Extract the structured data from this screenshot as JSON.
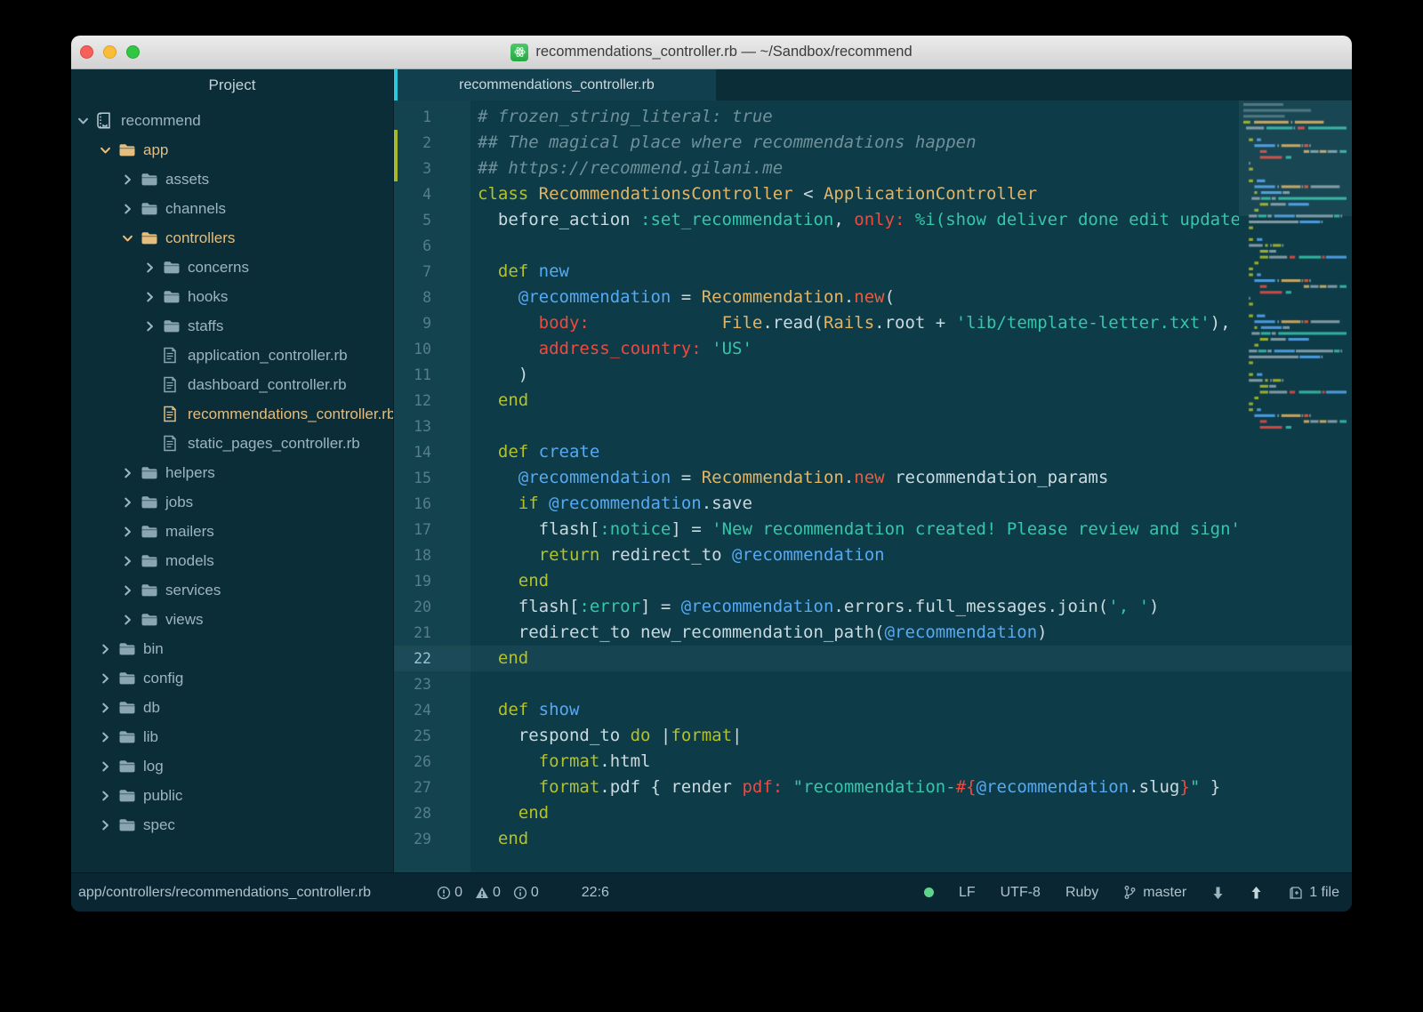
{
  "window": {
    "title": "recommendations_controller.rb — ~/Sandbox/recommend"
  },
  "sidebar": {
    "header": "Project",
    "tree": [
      {
        "label": "recommend",
        "icon": "book",
        "indent": 0,
        "chevron": "expanded",
        "accent": false
      },
      {
        "label": "app",
        "icon": "folder",
        "indent": 1,
        "chevron": "expanded",
        "accent": true
      },
      {
        "label": "assets",
        "icon": "folder",
        "indent": 2,
        "chevron": "collapsed",
        "accent": false
      },
      {
        "label": "channels",
        "icon": "folder",
        "indent": 2,
        "chevron": "collapsed",
        "accent": false
      },
      {
        "label": "controllers",
        "icon": "folder",
        "indent": 2,
        "chevron": "expanded",
        "accent": true
      },
      {
        "label": "concerns",
        "icon": "folder",
        "indent": 3,
        "chevron": "collapsed",
        "accent": false
      },
      {
        "label": "hooks",
        "icon": "folder",
        "indent": 3,
        "chevron": "collapsed",
        "accent": false
      },
      {
        "label": "staffs",
        "icon": "folder",
        "indent": 3,
        "chevron": "collapsed",
        "accent": false
      },
      {
        "label": "application_controller.rb",
        "icon": "file",
        "indent": 3,
        "chevron": "none",
        "accent": false
      },
      {
        "label": "dashboard_controller.rb",
        "icon": "file",
        "indent": 3,
        "chevron": "none",
        "accent": false
      },
      {
        "label": "recommendations_controller.rb",
        "icon": "file",
        "indent": 3,
        "chevron": "none",
        "accent": true
      },
      {
        "label": "static_pages_controller.rb",
        "icon": "file",
        "indent": 3,
        "chevron": "none",
        "accent": false
      },
      {
        "label": "helpers",
        "icon": "folder",
        "indent": 2,
        "chevron": "collapsed",
        "accent": false
      },
      {
        "label": "jobs",
        "icon": "folder",
        "indent": 2,
        "chevron": "collapsed",
        "accent": false
      },
      {
        "label": "mailers",
        "icon": "folder",
        "indent": 2,
        "chevron": "collapsed",
        "accent": false
      },
      {
        "label": "models",
        "icon": "folder",
        "indent": 2,
        "chevron": "collapsed",
        "accent": false
      },
      {
        "label": "services",
        "icon": "folder",
        "indent": 2,
        "chevron": "collapsed",
        "accent": false
      },
      {
        "label": "views",
        "icon": "folder",
        "indent": 2,
        "chevron": "collapsed",
        "accent": false
      },
      {
        "label": "bin",
        "icon": "folder",
        "indent": 1,
        "chevron": "collapsed",
        "accent": false
      },
      {
        "label": "config",
        "icon": "folder",
        "indent": 1,
        "chevron": "collapsed",
        "accent": false
      },
      {
        "label": "db",
        "icon": "folder",
        "indent": 1,
        "chevron": "collapsed",
        "accent": false
      },
      {
        "label": "lib",
        "icon": "folder",
        "indent": 1,
        "chevron": "collapsed",
        "accent": false
      },
      {
        "label": "log",
        "icon": "folder",
        "indent": 1,
        "chevron": "collapsed",
        "accent": false
      },
      {
        "label": "public",
        "icon": "folder",
        "indent": 1,
        "chevron": "collapsed",
        "accent": false
      },
      {
        "label": "spec",
        "icon": "folder",
        "indent": 1,
        "chevron": "collapsed",
        "accent": false
      }
    ]
  },
  "editor": {
    "tab": "recommendations_controller.rb",
    "cursor_line": 22,
    "git_modified_lines": [
      2,
      3
    ],
    "lines": [
      {
        "n": 1,
        "tokens": [
          [
            "comment",
            "# frozen_string_literal: true"
          ]
        ]
      },
      {
        "n": 2,
        "tokens": [
          [
            "comment",
            "## The magical place where recommendations happen"
          ]
        ]
      },
      {
        "n": 3,
        "tokens": [
          [
            "comment",
            "## https://recommend.gilani.me"
          ]
        ]
      },
      {
        "n": 4,
        "tokens": [
          [
            "kw",
            "class"
          ],
          [
            "plain",
            " "
          ],
          [
            "const",
            "RecommendationsController"
          ],
          [
            "plain",
            " < "
          ],
          [
            "const",
            "ApplicationController"
          ]
        ]
      },
      {
        "n": 5,
        "tokens": [
          [
            "plain",
            "  before_action "
          ],
          [
            "sym",
            ":set_recommendation"
          ],
          [
            "plain",
            ", "
          ],
          [
            "kwarg",
            "only:"
          ],
          [
            "plain",
            " "
          ],
          [
            "str",
            "%i(show deliver done edit update destroy)"
          ]
        ]
      },
      {
        "n": 6,
        "tokens": []
      },
      {
        "n": 7,
        "tokens": [
          [
            "plain",
            "  "
          ],
          [
            "kw",
            "def"
          ],
          [
            "plain",
            " "
          ],
          [
            "fname",
            "new"
          ]
        ]
      },
      {
        "n": 8,
        "tokens": [
          [
            "plain",
            "    "
          ],
          [
            "ivar",
            "@recommendation"
          ],
          [
            "plain",
            " = "
          ],
          [
            "const",
            "Recommendation"
          ],
          [
            "plain",
            "."
          ],
          [
            "mcall",
            "new"
          ],
          [
            "plain",
            "("
          ]
        ]
      },
      {
        "n": 9,
        "tokens": [
          [
            "plain",
            "      "
          ],
          [
            "kwarg",
            "body:"
          ],
          [
            "plain",
            "             "
          ],
          [
            "const",
            "File"
          ],
          [
            "plain",
            ".read("
          ],
          [
            "const",
            "Rails"
          ],
          [
            "plain",
            ".root + "
          ],
          [
            "str",
            "'lib/template-letter.txt'"
          ],
          [
            "plain",
            "),"
          ]
        ]
      },
      {
        "n": 10,
        "tokens": [
          [
            "plain",
            "      "
          ],
          [
            "kwarg",
            "address_country:"
          ],
          [
            "plain",
            " "
          ],
          [
            "str",
            "'US'"
          ]
        ]
      },
      {
        "n": 11,
        "tokens": [
          [
            "plain",
            "    )"
          ]
        ]
      },
      {
        "n": 12,
        "tokens": [
          [
            "plain",
            "  "
          ],
          [
            "kw",
            "end"
          ]
        ]
      },
      {
        "n": 13,
        "tokens": []
      },
      {
        "n": 14,
        "tokens": [
          [
            "plain",
            "  "
          ],
          [
            "kw",
            "def"
          ],
          [
            "plain",
            " "
          ],
          [
            "fname",
            "create"
          ]
        ]
      },
      {
        "n": 15,
        "tokens": [
          [
            "plain",
            "    "
          ],
          [
            "ivar",
            "@recommendation"
          ],
          [
            "plain",
            " = "
          ],
          [
            "const",
            "Recommendation"
          ],
          [
            "plain",
            "."
          ],
          [
            "mcall",
            "new"
          ],
          [
            "plain",
            " recommendation_params"
          ]
        ]
      },
      {
        "n": 16,
        "tokens": [
          [
            "plain",
            "    "
          ],
          [
            "kw",
            "if"
          ],
          [
            "plain",
            " "
          ],
          [
            "ivar",
            "@recommendation"
          ],
          [
            "plain",
            ".save"
          ]
        ]
      },
      {
        "n": 17,
        "tokens": [
          [
            "plain",
            "      flash["
          ],
          [
            "sym",
            ":notice"
          ],
          [
            "plain",
            "] = "
          ],
          [
            "str",
            "'New recommendation created! Please review and sign'"
          ]
        ]
      },
      {
        "n": 18,
        "tokens": [
          [
            "plain",
            "      "
          ],
          [
            "kw",
            "return"
          ],
          [
            "plain",
            " redirect_to "
          ],
          [
            "ivar",
            "@recommendation"
          ]
        ]
      },
      {
        "n": 19,
        "tokens": [
          [
            "plain",
            "    "
          ],
          [
            "kw",
            "end"
          ]
        ]
      },
      {
        "n": 20,
        "tokens": [
          [
            "plain",
            "    flash["
          ],
          [
            "sym",
            ":error"
          ],
          [
            "plain",
            "] = "
          ],
          [
            "ivar",
            "@recommendation"
          ],
          [
            "plain",
            ".errors.full_messages.join("
          ],
          [
            "str",
            "', '"
          ],
          [
            "plain",
            ")"
          ]
        ]
      },
      {
        "n": 21,
        "tokens": [
          [
            "plain",
            "    redirect_to new_recommendation_path("
          ],
          [
            "ivar",
            "@recommendation"
          ],
          [
            "plain",
            ")"
          ]
        ]
      },
      {
        "n": 22,
        "tokens": [
          [
            "plain",
            "  "
          ],
          [
            "kw",
            "end"
          ]
        ]
      },
      {
        "n": 23,
        "tokens": []
      },
      {
        "n": 24,
        "tokens": [
          [
            "plain",
            "  "
          ],
          [
            "kw",
            "def"
          ],
          [
            "plain",
            " "
          ],
          [
            "fname",
            "show"
          ]
        ]
      },
      {
        "n": 25,
        "tokens": [
          [
            "plain",
            "    respond_to "
          ],
          [
            "kw",
            "do"
          ],
          [
            "plain",
            " |"
          ],
          [
            "param",
            "format"
          ],
          [
            "plain",
            "|"
          ]
        ]
      },
      {
        "n": 26,
        "tokens": [
          [
            "plain",
            "      "
          ],
          [
            "param",
            "format"
          ],
          [
            "plain",
            ".html"
          ]
        ]
      },
      {
        "n": 27,
        "tokens": [
          [
            "plain",
            "      "
          ],
          [
            "param",
            "format"
          ],
          [
            "plain",
            ".pdf { render "
          ],
          [
            "kwarg",
            "pdf:"
          ],
          [
            "plain",
            " "
          ],
          [
            "str",
            "\"recommendation-"
          ],
          [
            "interp",
            "#{"
          ],
          [
            "ivar",
            "@recommendation"
          ],
          [
            "plain",
            ".slug"
          ],
          [
            "interp",
            "}"
          ],
          [
            "str",
            "\""
          ],
          [
            "plain",
            " }"
          ]
        ]
      },
      {
        "n": 28,
        "tokens": [
          [
            "plain",
            "    "
          ],
          [
            "kw",
            "end"
          ]
        ]
      },
      {
        "n": 29,
        "tokens": [
          [
            "plain",
            "  "
          ],
          [
            "kw",
            "end"
          ]
        ]
      }
    ]
  },
  "status": {
    "path": "app/controllers/recommendations_controller.rb",
    "errors": "0",
    "warnings": "0",
    "infos": "0",
    "cursor": "22:6",
    "line_ending": "LF",
    "encoding": "UTF-8",
    "language": "Ruby",
    "branch": "master",
    "files": "1 file"
  },
  "colors": {
    "accent_cyan": "#2cc8de",
    "editor_bg": "#0d3b48",
    "gutter_bg": "#13434f",
    "panel_bg": "#0a2d38",
    "status_bg": "#0a2632",
    "tree_accent": "#e5bd7e",
    "git_modified": "#a9b82b",
    "status_ok_dot": "#5fd38d",
    "token_keyword": "#b2c12c",
    "token_constant": "#e2b566",
    "token_string": "#38c5ab",
    "token_variable": "#57a9f2",
    "token_method_call": "#e85c3f",
    "token_kwarg": "#ee4b40",
    "token_comment": "#70919c"
  }
}
